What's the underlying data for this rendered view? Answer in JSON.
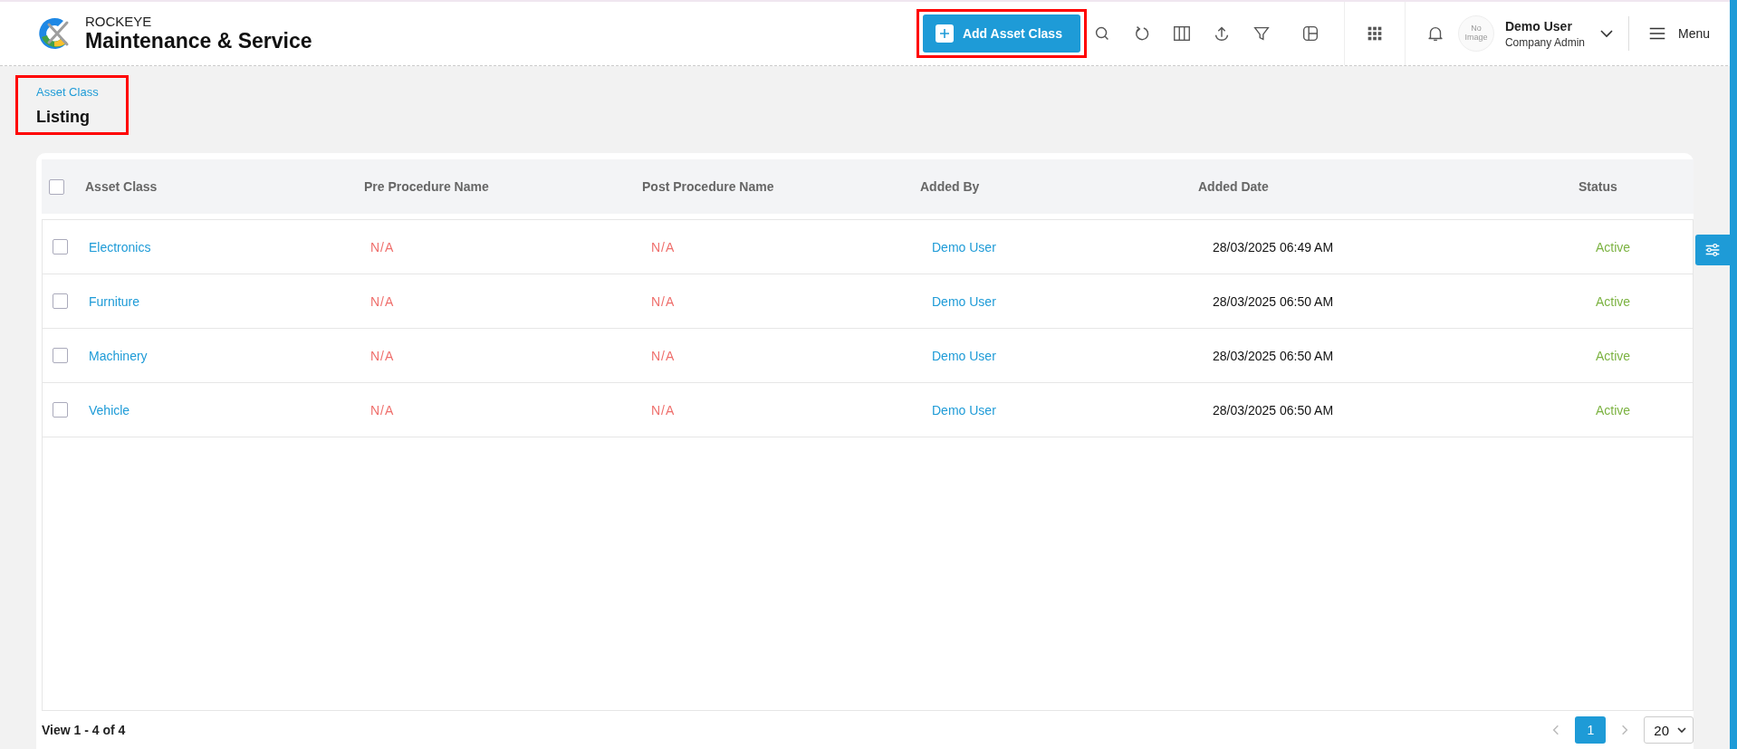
{
  "header": {
    "brand_top": "ROCKEYE",
    "brand_name": "Maintenance & Service",
    "add_button": {
      "label": "Add Asset Class",
      "highlighted": true
    },
    "user": {
      "avatar_text": "No Image",
      "name": "Demo User",
      "role": "Company Admin"
    },
    "menu_label": "Menu"
  },
  "breadcrumb": {
    "parent": "Asset Class",
    "title": "Listing",
    "highlighted": true
  },
  "table": {
    "header_checked": false,
    "columns": [
      "Asset Class",
      "Pre Procedure Name",
      "Post Procedure Name",
      "Added By",
      "Added Date",
      "Status"
    ],
    "rows": [
      {
        "checked": false,
        "asset_class": "Electronics",
        "pre_procedure": "N/A",
        "post_procedure": "N/A",
        "added_by": "Demo User",
        "added_date": "28/03/2025 06:49 AM",
        "status": "Active"
      },
      {
        "checked": false,
        "asset_class": "Furniture",
        "pre_procedure": "N/A",
        "post_procedure": "N/A",
        "added_by": "Demo User",
        "added_date": "28/03/2025 06:50 AM",
        "status": "Active"
      },
      {
        "checked": false,
        "asset_class": "Machinery",
        "pre_procedure": "N/A",
        "post_procedure": "N/A",
        "added_by": "Demo User",
        "added_date": "28/03/2025 06:50 AM",
        "status": "Active"
      },
      {
        "checked": false,
        "asset_class": "Vehicle",
        "pre_procedure": "N/A",
        "post_procedure": "N/A",
        "added_by": "Demo User",
        "added_date": "28/03/2025 06:50 AM",
        "status": "Active"
      }
    ]
  },
  "footer": {
    "summary": "View 1 - 4 of 4",
    "pages": [
      {
        "label": "1",
        "selected": true
      }
    ],
    "page_size": "20"
  }
}
